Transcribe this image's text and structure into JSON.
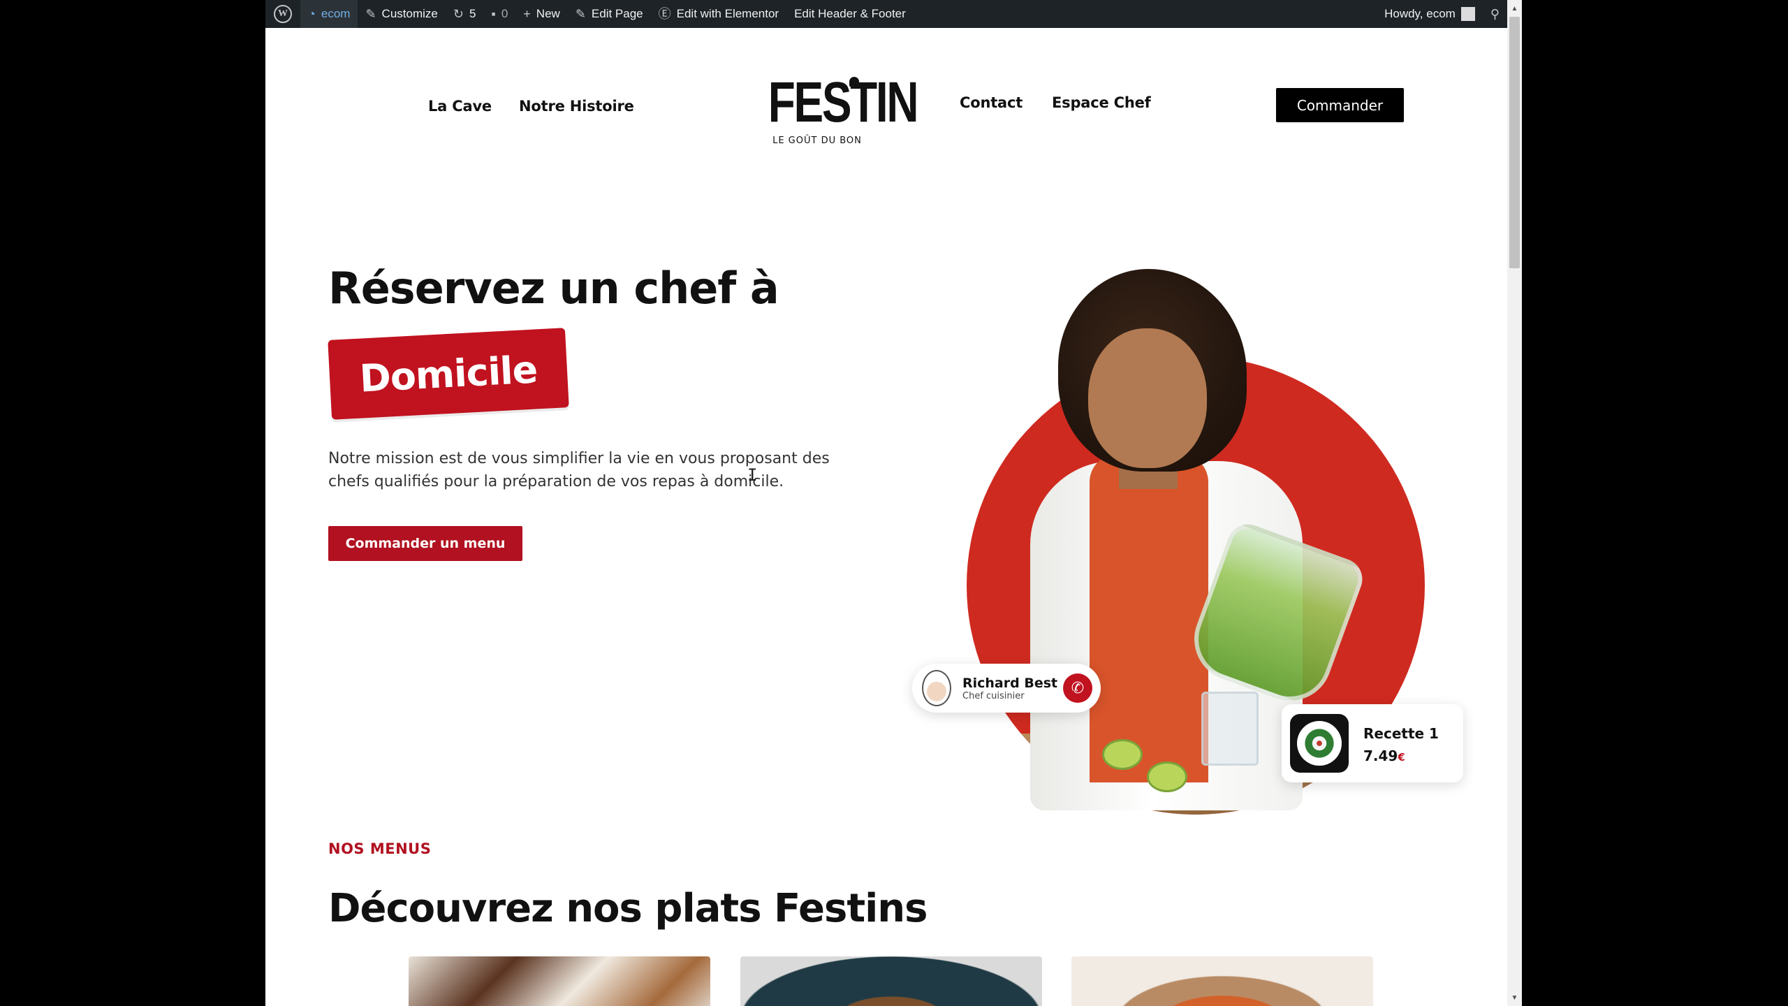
{
  "adminbar": {
    "site_name": "ecom",
    "customize": "Customize",
    "updates_count": "5",
    "comments_count": "0",
    "new": "New",
    "edit_page": "Edit Page",
    "edit_elementor": "Edit with Elementor",
    "edit_header_footer": "Edit Header & Footer",
    "howdy": "Howdy, ecom"
  },
  "nav": {
    "left": [
      "La Cave",
      "Notre Histoire"
    ],
    "right": [
      "Contact",
      "Espace Chef"
    ],
    "cta": "Commander"
  },
  "logo": {
    "brand": "FESTIN",
    "tagline": "LE GOÛT DU BON"
  },
  "hero": {
    "title": "Réservez un chef à",
    "badge": "Domicile",
    "description": "Notre mission est de vous simplifier la vie en vous proposant des chefs qualifiés pour la préparation de vos repas à domicile.",
    "button": "Commander un menu"
  },
  "chef_card": {
    "name": "Richard Best",
    "role": "Chef cuisinier"
  },
  "recipe_card": {
    "title": "Recette 1",
    "price": "7.49",
    "currency": "€"
  },
  "menus": {
    "eyebrow": "NOS MENUS",
    "title": "Découvrez nos plats Festins"
  },
  "colors": {
    "accent": "#c1121f",
    "adminbar": "#1d2327",
    "hero_circle": "#cf2a20"
  },
  "icons": {
    "wordpress": "wordpress-logo-icon",
    "dashboard": "dashboard-icon",
    "customize": "brush-icon",
    "updates": "refresh-icon",
    "comments": "comment-icon",
    "new": "plus-icon",
    "edit": "pencil-icon",
    "elementor": "elementor-icon",
    "search": "search-icon",
    "phone": "phone-icon"
  }
}
